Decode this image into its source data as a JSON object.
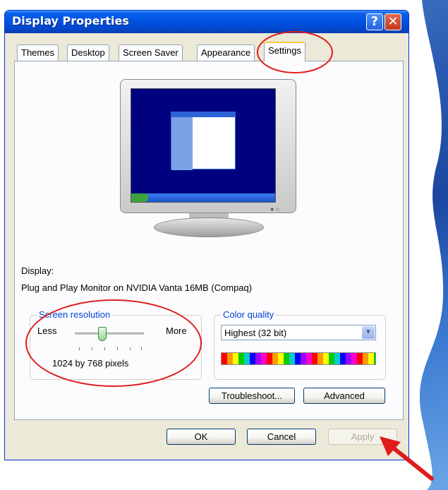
{
  "window": {
    "title": "Display Properties",
    "help_label": "?",
    "close_label": "✕"
  },
  "tabs": [
    {
      "label": "Themes",
      "active": false
    },
    {
      "label": "Desktop",
      "active": false
    },
    {
      "label": "Screen Saver",
      "active": false
    },
    {
      "label": "Appearance",
      "active": false
    },
    {
      "label": "Settings",
      "active": true
    }
  ],
  "settings": {
    "display_label": "Display:",
    "display_device": "Plug and Play Monitor on NVIDIA Vanta 16MB (Compaq)",
    "resolution": {
      "group_title": "Screen resolution",
      "less_label": "Less",
      "more_label": "More",
      "value_text": "1024 by 768 pixels",
      "slider_fraction": 0.4
    },
    "color_quality": {
      "group_title": "Color quality",
      "selected": "Highest (32 bit)"
    },
    "troubleshoot_label": "Troubleshoot...",
    "advanced_label": "Advanced"
  },
  "footer": {
    "ok_label": "OK",
    "cancel_label": "Cancel",
    "apply_label": "Apply",
    "apply_disabled": true
  },
  "colors": {
    "annotation": "#e01b1b",
    "titlebar": "#0055e5",
    "dialog_face": "#ece9d8"
  }
}
